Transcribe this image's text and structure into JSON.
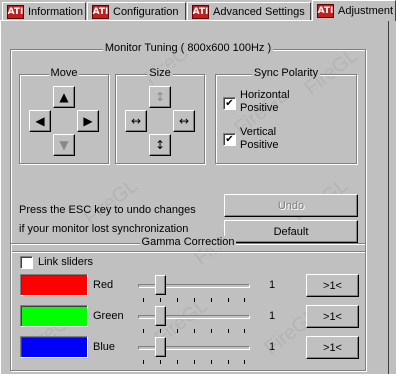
{
  "tabs": [
    {
      "label": "Information",
      "icon": "ati-logo-icon"
    },
    {
      "label": "Configuration",
      "icon": "ati-logo-icon"
    },
    {
      "label": "Advanced Settings",
      "icon": "ati-logo-icon"
    },
    {
      "label": "Adjustment",
      "icon": "ati-logo-icon",
      "active": true
    }
  ],
  "tab_icon_text": "ATI",
  "watermark_text": "FireGL",
  "monitor_tuning": {
    "title": "Monitor Tuning ( 800x600 100Hz )",
    "move": {
      "title": "Move"
    },
    "size": {
      "title": "Size"
    },
    "sync_polarity": {
      "title": "Sync Polarity",
      "horizontal_line1": "Horizontal",
      "horizontal_line2": "Positive",
      "horizontal_checked": true,
      "vertical_line1": "Vertical",
      "vertical_line2": "Positive",
      "vertical_checked": true
    },
    "esc_line1": "Press the ESC key to undo changes",
    "esc_line2": "if your monitor lost synchronization",
    "undo_label": "Undo",
    "default_label": "Default"
  },
  "gamma": {
    "title": "Gamma Correction",
    "link_sliders_label": "Link sliders",
    "link_sliders_checked": false,
    "channels": [
      {
        "name": "Red",
        "color": "#ff0000",
        "value": "1",
        "reset_label": ">1<"
      },
      {
        "name": "Green",
        "color": "#00ff00",
        "value": "1",
        "reset_label": ">1<"
      },
      {
        "name": "Blue",
        "color": "#0000ff",
        "value": "1",
        "reset_label": ">1<"
      }
    ]
  },
  "colors": {
    "face": "#c0c0c0",
    "tab_icon": "#c0201e"
  }
}
